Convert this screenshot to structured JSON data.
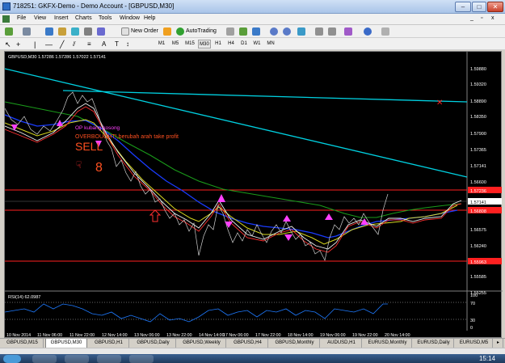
{
  "window": {
    "title": "718251: GKFX-Demo - Demo Account - [GBPUSD,M30]"
  },
  "menu": [
    "File",
    "View",
    "Insert",
    "Charts",
    "Tools",
    "Window",
    "Help"
  ],
  "toolbar": {
    "new_order": "New Order",
    "autotrading": "AutoTrading"
  },
  "timeframes": [
    "M1",
    "M5",
    "M15",
    "M30",
    "H1",
    "H4",
    "D1",
    "W1",
    "MN"
  ],
  "chart": {
    "header": "GBPUSD,M30  1.57286 1.57286 1.57022 1.57141",
    "annotation_line1": "OP kubang kosong",
    "annotation_line2": "OVERBOUGHT!,berubah arah take profit",
    "sell_label": "SELL",
    "sell_number": "8",
    "price_labels": [
      "1.59880",
      "1.59320",
      "1.58890",
      "1.58350",
      "1.57900",
      "1.57365",
      "1.57141",
      "1.56600",
      "1.56575",
      "1.56240",
      "1.55600",
      "1.55585",
      "1.55255"
    ],
    "price_badge_red_top": "1.57236",
    "price_badge_current": "1.57141",
    "price_badge_red_mid": "1.56808",
    "price_badge_red_low": "1.55963",
    "rsi_label": "RSI(14) 62.0987",
    "rsi_levels": [
      "100",
      "70",
      "30",
      "0"
    ],
    "time_labels": [
      "10 Nov 2014",
      "11 Nov 06:00",
      "11 Nov 22:00",
      "12 Nov 14:00",
      "13 Nov 06:00",
      "13 Nov 22:00",
      "14 Nov 14:00",
      "17 Nov 06:00",
      "17 Nov 22:00",
      "18 Nov 14:00",
      "19 Nov 06:00",
      "19 Nov 22:00",
      "20 Nov 14:00"
    ]
  },
  "tabs": [
    "GBPUSD,M15",
    "GBPUSD,M30",
    "GBPUSD,H1",
    "GBPUSD,Daily",
    "GBPUSD,Weekly",
    "GBPUSD,H4",
    "GBPUSD,Monthly",
    "AUDUSD,H1",
    "EURUSD,Monthly",
    "EURUSD,Daily",
    "EURUSD,M5"
  ],
  "taskbar": {
    "clock": "15:14"
  },
  "colors": {
    "chart_bg": "#000000",
    "trend": "#00d0e0",
    "red_level": "#ff2020",
    "ma_green": "#1a9a1a",
    "ma_blue": "#1a3cff",
    "ma_yellow": "#d8d820",
    "signal": "#ff40ff"
  }
}
